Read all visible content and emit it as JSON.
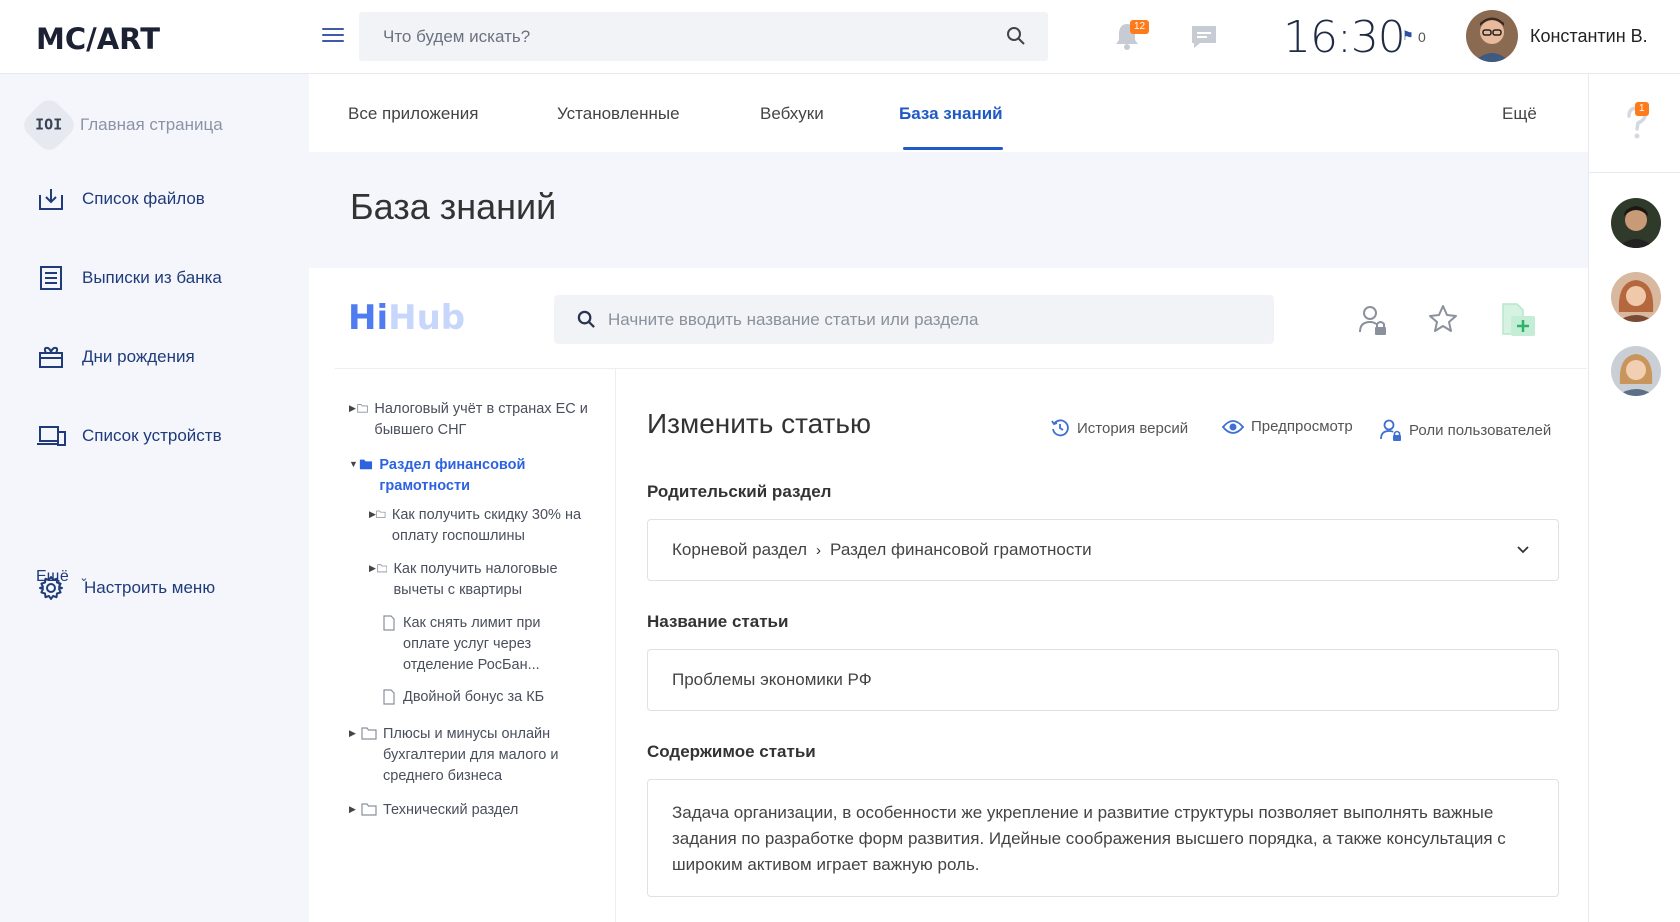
{
  "topbar": {
    "logo": "MC/ART",
    "search_placeholder": "Что будем искать?",
    "notifications_count": "12",
    "time": "16:30",
    "flag_count": "0",
    "user_name": "Константин В."
  },
  "sidebar": {
    "items": [
      {
        "label": "Главная страница",
        "icon": "home-icon"
      },
      {
        "label": "Список файлов",
        "icon": "download-icon"
      },
      {
        "label": "Выписки из банка",
        "icon": "document-list-icon"
      },
      {
        "label": "Дни рождения",
        "icon": "gift-icon"
      },
      {
        "label": "Список устройств",
        "icon": "devices-icon"
      }
    ],
    "more_label": "Ещё",
    "settings_label": "Настроить меню"
  },
  "tabs": [
    {
      "label": "Все приложения"
    },
    {
      "label": "Установленные"
    },
    {
      "label": "Вебхуки"
    },
    {
      "label": "База знаний"
    }
  ],
  "tabs_more": "Ещё",
  "page_title": "База знаний",
  "kb": {
    "logo_hi": "Hi",
    "logo_hub": "Hub",
    "search_placeholder": "Начните вводить название статьи или раздела"
  },
  "tree": [
    {
      "title": "Налоговый учёт в странах ЕС и бывшего СНГ"
    },
    {
      "title": "Раздел финансовой грамотности"
    },
    {
      "title": "Как получить скидку 30% на оплату госпошлины"
    },
    {
      "title": "Как получить налоговые вычеты с квартиры"
    },
    {
      "title": "Как снять лимит при оплате услуг через отделение РосБан..."
    },
    {
      "title": "Двойной бонус за КБ"
    },
    {
      "title": "Плюсы и минусы онлайн бухгалтерии для малого и среднего бизнеса"
    },
    {
      "title": "Технический раздел"
    }
  ],
  "form": {
    "title": "Изменить статью",
    "actions": {
      "history": "История версий",
      "preview": "Предпросмотр",
      "roles": "Роли пользователей"
    },
    "parent_label": "Родительский раздел",
    "parent_root": "Корневой раздел",
    "parent_section": "Раздел финансовой грамотности",
    "name_label": "Название статьи",
    "name_value": "Проблемы экономики РФ",
    "content_label": "Содержимое статьи",
    "content_value": "Задача организации, в особенности же укрепление и развитие структуры позволяет выполнять важные задания по разработке форм развития. Идейные соображения высшего порядка, а также консультация с широким активом играет важную роль."
  },
  "help_badge": "1",
  "colors": {
    "accent": "#1f5bc5",
    "nav_text": "#1f3b7a",
    "badge": "#ff7a1a",
    "hihub_primary": "#4f7df0"
  }
}
